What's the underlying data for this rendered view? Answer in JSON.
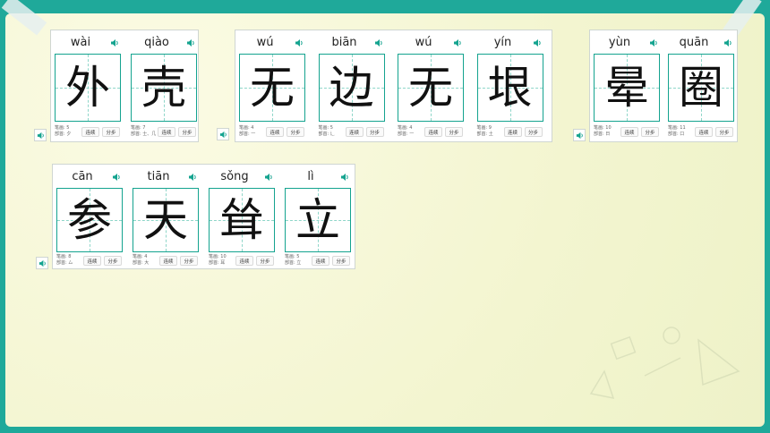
{
  "colors": {
    "accent": "#14a38f",
    "frame": "#1fa99a",
    "board": "#f6f7d6"
  },
  "icons": {
    "speaker": "speaker-icon"
  },
  "cards": [
    {
      "chars": [
        {
          "pinyin": "wài",
          "char": "外",
          "strokes": "笔画: 5",
          "radical": "部首: 夕"
        },
        {
          "pinyin": "qiào",
          "char": "壳",
          "strokes": "笔画: 7",
          "radical": "部首: 士、几"
        }
      ]
    },
    {
      "chars": [
        {
          "pinyin": "wú",
          "char": "无",
          "strokes": "笔画: 4",
          "radical": "部首: 一"
        },
        {
          "pinyin": "biān",
          "char": "边",
          "strokes": "笔画: 5",
          "radical": "部首: 辶"
        },
        {
          "pinyin": "wú",
          "char": "无",
          "strokes": "笔画: 4",
          "radical": "部首: 一"
        },
        {
          "pinyin": "yín",
          "char": "垠",
          "strokes": "笔画: 9",
          "radical": "部首: 土"
        }
      ]
    },
    {
      "chars": [
        {
          "pinyin": "yùn",
          "char": "晕",
          "strokes": "笔画: 10",
          "radical": "部首: 日"
        },
        {
          "pinyin": "quān",
          "char": "圈",
          "strokes": "笔画: 11",
          "radical": "部首: 口"
        }
      ]
    },
    {
      "chars": [
        {
          "pinyin": "cān",
          "char": "参",
          "strokes": "笔画: 8",
          "radical": "部首: 厶"
        },
        {
          "pinyin": "tiān",
          "char": "天",
          "strokes": "笔画: 4",
          "radical": "部首: 大"
        },
        {
          "pinyin": "sǒng",
          "char": "耸",
          "strokes": "笔画: 10",
          "radical": "部首: 耳"
        },
        {
          "pinyin": "lì",
          "char": "立",
          "strokes": "笔画: 5",
          "radical": "部首: 立"
        }
      ]
    }
  ],
  "buttons": {
    "continuous": "连续",
    "stepwise": "分步"
  }
}
